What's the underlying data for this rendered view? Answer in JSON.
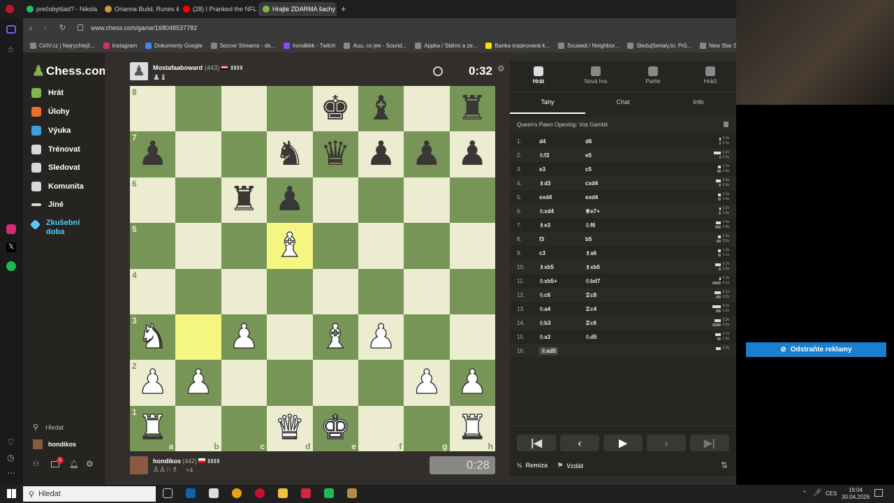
{
  "browser": {
    "tabs": [
      {
        "title": "prečobytšad? - Nikola",
        "color": "#21c25e"
      },
      {
        "title": "Orianna Build, Runes & Co",
        "color": "#c89b3c"
      },
      {
        "title": "(28) I Pranked the NFL Dr",
        "color": "#ff0000"
      },
      {
        "title": "Hrajte ZDARMA šachy",
        "color": "#81b64c"
      }
    ],
    "new_tab": "+",
    "url": "www.chess.com/game/168048537782",
    "bookmarks": [
      "CtrlV.cz | Nejrychlejš...",
      "Instagram",
      "Dokumenty Google",
      "Soccer Streams - de...",
      "hondikkk - Twitch",
      "Auu, co jee - Sound...",
      "Appka / Stáhni a ze...",
      "Banka inspirovaná k...",
      "Sousedi / Neighbor...",
      "SledujSerialy.to: Prů...",
      "New Star Soccer"
    ]
  },
  "site": {
    "logo": "Chess.com",
    "nav": [
      {
        "label": "Hrát",
        "color": "#81b64c"
      },
      {
        "label": "Úlohy",
        "color": "#e8702a"
      },
      {
        "label": "Výuka",
        "color": "#3aa0e0"
      },
      {
        "label": "Trénovat",
        "color": "#d9d9d9"
      },
      {
        "label": "Sledovat",
        "color": "#d9d9d9"
      },
      {
        "label": "Komunita",
        "color": "#d9d9d9"
      },
      {
        "label": "Jiné",
        "color": "#d9d9d9"
      }
    ],
    "trial": "Zkušební doba",
    "search": "Hledat",
    "user": "hondikos",
    "notif_count": "1"
  },
  "game": {
    "top_player": {
      "name": "Mostafaaboward",
      "rating": "(443)",
      "time": "0:32",
      "captured": "♟♝"
    },
    "bottom_player": {
      "name": "hondikos",
      "rating": "(442)",
      "time": "0:28",
      "captured": "♙♙♘♗",
      "advantage": "+4"
    },
    "board": [
      [
        "",
        "",
        "",
        "",
        "bk",
        "bb",
        "",
        "br"
      ],
      [
        "bp",
        "",
        "",
        "bn",
        "bq",
        "bp",
        "bp",
        "bp"
      ],
      [
        "",
        "",
        "br",
        "bp",
        "",
        "",
        "",
        ""
      ],
      [
        "",
        "",
        "",
        "wb",
        "",
        "",
        "",
        ""
      ],
      [
        "",
        "",
        "",
        "",
        "",
        "",
        "",
        ""
      ],
      [
        "wn",
        "",
        "wp",
        "",
        "wb",
        "wp",
        "",
        ""
      ],
      [
        "wp",
        "wp",
        "",
        "",
        "",
        "",
        "wp",
        "wp"
      ],
      [
        "wr",
        "",
        "",
        "wq",
        "wk",
        "",
        "",
        "wr"
      ]
    ],
    "highlight": [
      [
        5,
        1
      ],
      [
        3,
        3
      ]
    ],
    "ranks": [
      "8",
      "7",
      "6",
      "5",
      "4",
      "3",
      "2",
      "1"
    ],
    "files": [
      "a",
      "b",
      "c",
      "d",
      "e",
      "f",
      "g",
      "h"
    ]
  },
  "panel": {
    "tabs": [
      "Hrát",
      "Nová hra",
      "Partie",
      "Hráči"
    ],
    "subtabs": [
      "Tahy",
      "Chat",
      "Info"
    ],
    "opening": "Queen's Pawn Opening: Vos Gambit",
    "moves": [
      {
        "n": "1.",
        "w": "d4",
        "b": "d6",
        "wt": "0.3s",
        "bt": "0.3s",
        "wl": 0.1,
        "bl": 0.1
      },
      {
        "n": "2.",
        "w": "♘f3",
        "b": "e5",
        "wt": "3.3s",
        "bt": "0.1s",
        "wl": 0.5,
        "bl": 0.05
      },
      {
        "n": "3.",
        "w": "e3",
        "b": "c5",
        "wt": "1.2s",
        "bt": "1.8s",
        "wl": 0.2,
        "bl": 0.25
      },
      {
        "n": "4.",
        "w": "♗d3",
        "b": "cxd4",
        "wt": "2.4s",
        "bt": "0.9s",
        "wl": 0.35,
        "bl": 0.15
      },
      {
        "n": "5.",
        "w": "exd4",
        "b": "exd4",
        "wt": "1.2s",
        "bt": "1.4s",
        "wl": 0.2,
        "bl": 0.2
      },
      {
        "n": "6.",
        "w": "♘xd4",
        "b": "♕e7+",
        "wt": "0.2s",
        "bt": "1.0s",
        "wl": 0.05,
        "bl": 0.15
      },
      {
        "n": "7.",
        "w": "♗e3",
        "b": "♘f6",
        "wt": "2.4s",
        "bt": "2.8s",
        "wl": 0.35,
        "bl": 0.4
      },
      {
        "n": "8.",
        "w": "f3",
        "b": "b5",
        "wt": "1.5s",
        "bt": "2.0s",
        "wl": 0.22,
        "bl": 0.3
      },
      {
        "n": "9.",
        "w": "c3",
        "b": "♗a6",
        "wt": "1.2s",
        "bt": "1.1s",
        "wl": 0.2,
        "bl": 0.18
      },
      {
        "n": "10.",
        "w": "♗xb5",
        "b": "♗xb5",
        "wt": "2.7s",
        "bt": "1.0s",
        "wl": 0.4,
        "bl": 0.15
      },
      {
        "n": "11.",
        "w": "♘xb5+",
        "b": "♘bd7",
        "wt": "0.3s",
        "bt": "4.1s",
        "wl": 0.05,
        "bl": 0.6
      },
      {
        "n": "12.",
        "w": "♘c6",
        "b": "♖c8",
        "wt": "3.1s",
        "bt": "2.2s",
        "wl": 0.45,
        "bl": 0.35
      },
      {
        "n": "13.",
        "w": "♘a4",
        "b": "♖c4",
        "wt": "4.1s",
        "bt": "2.2s",
        "wl": 0.6,
        "bl": 0.35
      },
      {
        "n": "14.",
        "w": "♘b3",
        "b": "♖c6",
        "wt": "3.0s",
        "bt": "4.2s",
        "wl": 0.45,
        "bl": 0.6
      },
      {
        "n": "15.",
        "w": "♘a3",
        "b": "♘d5",
        "wt": "2.7s",
        "bt": "1.6s",
        "wl": 0.4,
        "bl": 0.25
      },
      {
        "n": "16.",
        "w": "♘xd5",
        "b": "",
        "wt": "2.3s",
        "bt": "",
        "wl": 0.35,
        "bl": 0
      }
    ],
    "draw": "Remíza",
    "resign": "Vzdát"
  },
  "ad": {
    "label": "Odstraňte reklamy"
  },
  "taskbar": {
    "search": "Hledat",
    "lang": "CES",
    "time": "19:04",
    "date": "30.04.2026"
  }
}
